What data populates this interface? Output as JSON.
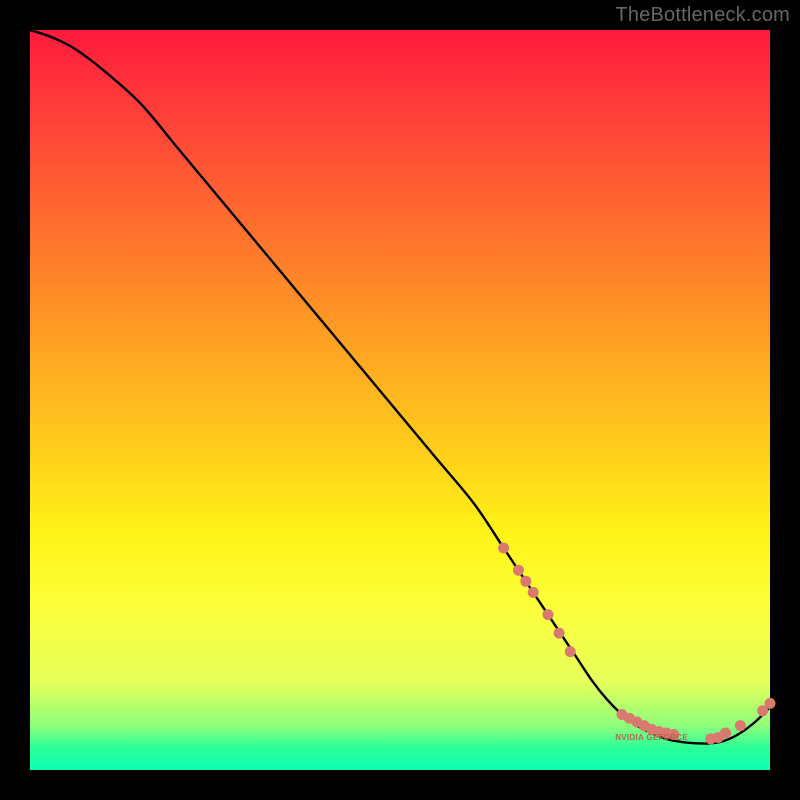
{
  "watermark": "TheBottleneck.com",
  "axes": {
    "x_range": [
      0,
      100
    ],
    "y_range": [
      0,
      100
    ]
  },
  "chart_data": {
    "type": "line",
    "title": "",
    "xlabel": "",
    "ylabel": "",
    "xlim": [
      0,
      100
    ],
    "ylim": [
      0,
      100
    ],
    "series": [
      {
        "name": "bottleneck-curve",
        "x": [
          0,
          3,
          6,
          10,
          15,
          20,
          25,
          30,
          35,
          40,
          45,
          50,
          55,
          60,
          64,
          66,
          68,
          70,
          72,
          74,
          76,
          78,
          80,
          82,
          84,
          86,
          88,
          90,
          92,
          94,
          96,
          98,
          100
        ],
        "values": [
          100,
          99,
          97.5,
          94.5,
          90,
          84,
          78,
          72,
          66,
          60,
          54,
          48,
          42,
          36,
          30,
          27,
          24,
          21,
          18,
          15,
          12,
          9.5,
          7.5,
          6,
          5,
          4.2,
          3.8,
          3.6,
          3.6,
          4,
          5,
          6.5,
          8.5
        ]
      }
    ],
    "markers": [
      {
        "name": "cluster-upper-dots",
        "points": [
          {
            "x": 64,
            "y": 30
          },
          {
            "x": 66,
            "y": 27
          },
          {
            "x": 67,
            "y": 25.5
          },
          {
            "x": 68,
            "y": 24
          },
          {
            "x": 70,
            "y": 21
          },
          {
            "x": 71.5,
            "y": 18.5
          },
          {
            "x": 73,
            "y": 16
          }
        ]
      },
      {
        "name": "cluster-bottom-dots",
        "points": [
          {
            "x": 80,
            "y": 7.5
          },
          {
            "x": 81,
            "y": 7
          },
          {
            "x": 82,
            "y": 6.5
          },
          {
            "x": 83,
            "y": 6
          },
          {
            "x": 84,
            "y": 5.5
          },
          {
            "x": 85,
            "y": 5.2
          },
          {
            "x": 86,
            "y": 5
          },
          {
            "x": 87,
            "y": 4.8
          },
          {
            "x": 92,
            "y": 4.2
          },
          {
            "x": 93,
            "y": 4.4
          },
          {
            "x": 94,
            "y": 5
          },
          {
            "x": 96,
            "y": 6
          },
          {
            "x": 99,
            "y": 8
          },
          {
            "x": 100,
            "y": 9
          }
        ]
      }
    ],
    "annotations": [
      {
        "name": "bottom-category-label",
        "text": "NVIDIA GEFORCE",
        "x": 84,
        "y": 4.5
      }
    ]
  }
}
